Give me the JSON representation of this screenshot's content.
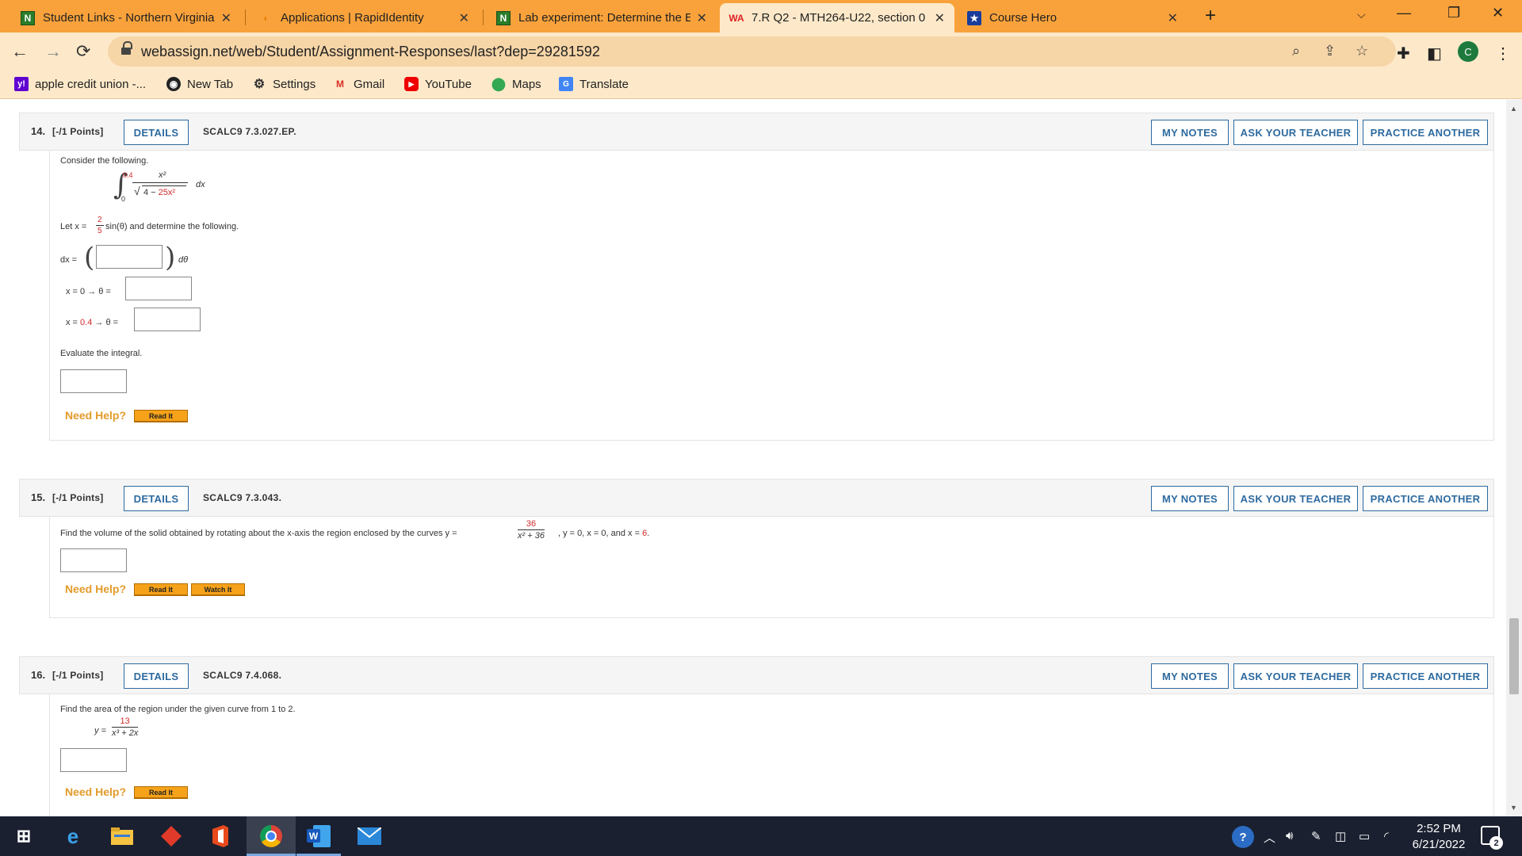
{
  "browser": {
    "tabs": [
      {
        "title": "Student Links - Northern Virginia",
        "favicon": "n-logo-icon",
        "active": false
      },
      {
        "title": "Applications | RapidIdentity",
        "favicon": "rapididentity-icon",
        "active": false
      },
      {
        "title": "Lab experiment: Determine the E",
        "favicon": "n-logo-icon",
        "active": false
      },
      {
        "title": "7.R Q2 - MTH264-U22, section 0",
        "favicon": "webassign-icon",
        "active": true
      },
      {
        "title": "Course Hero",
        "favicon": "coursehero-icon",
        "active": false
      }
    ],
    "url": "webassign.net/web/Student/Assignment-Responses/last?dep=29281592",
    "profile_initial": "C",
    "bookmarks": [
      {
        "label": "apple credit union -...",
        "icon": "yahoo-icon"
      },
      {
        "label": "New Tab",
        "icon": "chrome-icon"
      },
      {
        "label": "Settings",
        "icon": "gear-icon"
      },
      {
        "label": "Gmail",
        "icon": "gmail-icon"
      },
      {
        "label": "YouTube",
        "icon": "youtube-icon"
      },
      {
        "label": "Maps",
        "icon": "maps-icon"
      },
      {
        "label": "Translate",
        "icon": "translate-icon"
      }
    ]
  },
  "common": {
    "details": "DETAILS",
    "my_notes": "MY NOTES",
    "ask_teacher": "ASK YOUR TEACHER",
    "practice": "PRACTICE ANOTHER",
    "need_help": "Need Help?",
    "read_it": "Read It",
    "watch_it": "Watch It"
  },
  "q14": {
    "num": "14.",
    "points": "[-/1 Points]",
    "code": "SCALC9 7.3.027.EP.",
    "intro": "Consider the following.",
    "upper_limit": "0.4",
    "lower_limit": "0",
    "numerator": "x²",
    "radical_const": "4 − ",
    "radical_term": "25x²",
    "dx": "dx",
    "let_prefix": "Let x = ",
    "sub_num": "2",
    "sub_den": "5",
    "let_suffix": "sin(θ) and determine the following.",
    "dx_label": "dx =",
    "dtheta": "dθ",
    "lim1_label": "x = 0 → θ =",
    "lim2_prefix": "x = ",
    "lim2_value": "0.4",
    "lim2_suffix": " → θ =",
    "evaluate": "Evaluate the integral."
  },
  "q15": {
    "num": "15.",
    "points": "[-/1 Points]",
    "code": "SCALC9 7.3.043.",
    "text_a": "Find the volume of the solid obtained by rotating about the x-axis the region enclosed by the curves y = ",
    "numerator": "36",
    "denominator": "x² + 36",
    "text_b": ", y = 0, x = 0, and x = ",
    "x_value": "6",
    "text_c": "."
  },
  "q16": {
    "num": "16.",
    "points": "[-/1 Points]",
    "code": "SCALC9 7.4.068.",
    "text": "Find the area of the region under the given curve from 1 to 2.",
    "y_label": "y =",
    "numerator": "13",
    "denominator": "x³ + 2x"
  },
  "taskbar": {
    "apps": [
      "windows-start-icon",
      "edge-icon",
      "file-explorer-icon",
      "diamond-app-icon",
      "office-icon",
      "chrome-icon",
      "word-icon",
      "mail-icon"
    ],
    "time": "2:52 PM",
    "date": "6/21/2022",
    "notifications": "2"
  },
  "colors": {
    "tabbar": "#f9a23b",
    "toolbar": "#fde9c9",
    "link_blue": "#2d6a9f",
    "answer_red": "#d32a2a",
    "help_orange": "#e39b2a",
    "taskbar": "#1a2030"
  }
}
